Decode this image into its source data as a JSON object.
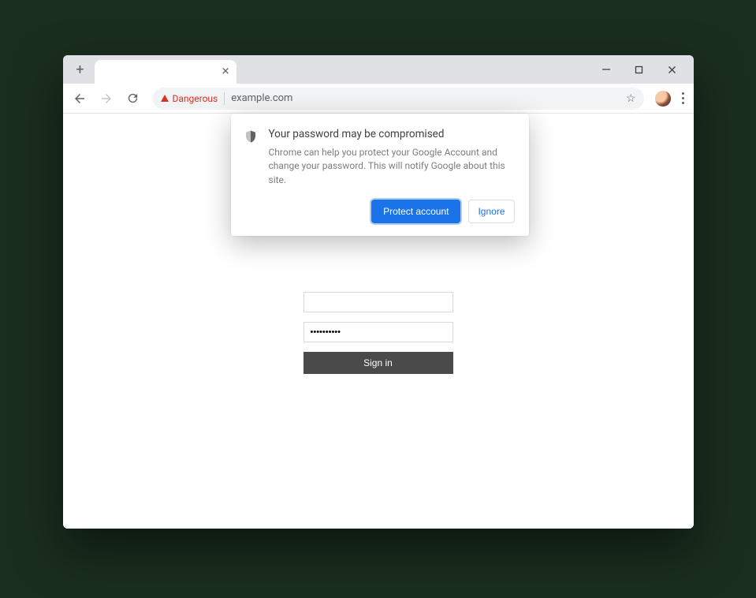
{
  "window_controls": {
    "minimize_glyph": "—",
    "maximize_glyph": "☐",
    "close_glyph": "✕"
  },
  "tabstrip": {
    "new_tab_glyph": "+",
    "tab_close_glyph": "✕"
  },
  "toolbar": {
    "security_label": "Dangerous",
    "url": "example.com",
    "star_glyph": "☆"
  },
  "popup": {
    "title": "Your password may be compromised",
    "body": "Chrome can help you protect your Google Account and change your password. This will notify Google about this site.",
    "primary_label": "Protect account",
    "secondary_label": "Ignore"
  },
  "form": {
    "username_value": "",
    "password_value": "••••••••••",
    "submit_label": "Sign in"
  }
}
